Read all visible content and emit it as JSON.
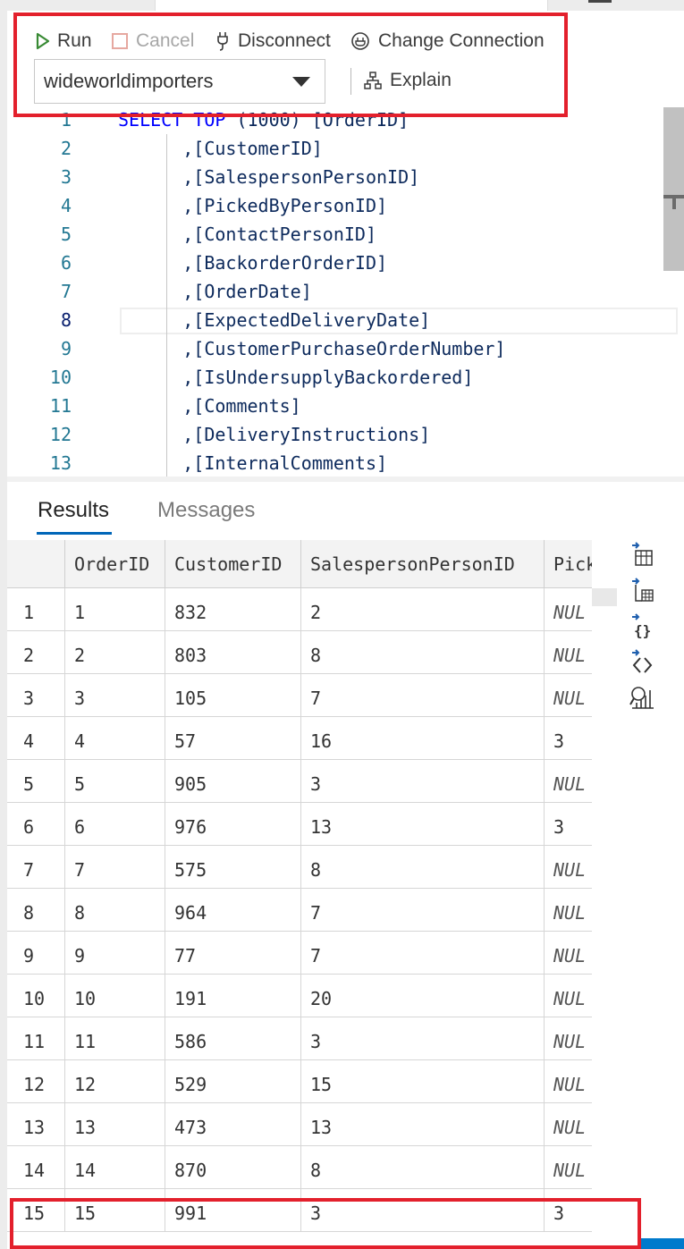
{
  "toolbar": {
    "run_label": "Run",
    "cancel_label": "Cancel",
    "disconnect_label": "Disconnect",
    "change_connection_label": "Change Connection",
    "database": "wideworldimporters",
    "explain_label": "Explain"
  },
  "editor": {
    "lines": [
      {
        "num": "1",
        "keyword": "SELECT TOP",
        "text": " (1000) [OrderID]"
      },
      {
        "num": "2",
        "keyword": "",
        "text": "      ,[CustomerID]"
      },
      {
        "num": "3",
        "keyword": "",
        "text": "      ,[SalespersonPersonID]"
      },
      {
        "num": "4",
        "keyword": "",
        "text": "      ,[PickedByPersonID]"
      },
      {
        "num": "5",
        "keyword": "",
        "text": "      ,[ContactPersonID]"
      },
      {
        "num": "6",
        "keyword": "",
        "text": "      ,[BackorderOrderID]"
      },
      {
        "num": "7",
        "keyword": "",
        "text": "      ,[OrderDate]"
      },
      {
        "num": "8",
        "keyword": "",
        "text": "      ,[ExpectedDeliveryDate]"
      },
      {
        "num": "9",
        "keyword": "",
        "text": "      ,[CustomerPurchaseOrderNumber]"
      },
      {
        "num": "10",
        "keyword": "",
        "text": "      ,[IsUndersupplyBackordered]"
      },
      {
        "num": "11",
        "keyword": "",
        "text": "      ,[Comments]"
      },
      {
        "num": "12",
        "keyword": "",
        "text": "      ,[DeliveryInstructions]"
      },
      {
        "num": "13",
        "keyword": "",
        "text": "      ,[InternalComments]"
      }
    ]
  },
  "results": {
    "tabs": [
      "Results",
      "Messages"
    ],
    "columns": [
      "OrderID",
      "CustomerID",
      "SalespersonPersonID",
      "Picked"
    ],
    "rows": [
      [
        "1",
        "1",
        "832",
        "2",
        "NUL"
      ],
      [
        "2",
        "2",
        "803",
        "8",
        "NUL"
      ],
      [
        "3",
        "3",
        "105",
        "7",
        "NUL"
      ],
      [
        "4",
        "4",
        "57",
        "16",
        "3"
      ],
      [
        "5",
        "5",
        "905",
        "3",
        "NUL"
      ],
      [
        "6",
        "6",
        "976",
        "13",
        "3"
      ],
      [
        "7",
        "7",
        "575",
        "8",
        "NUL"
      ],
      [
        "8",
        "8",
        "964",
        "7",
        "NUL"
      ],
      [
        "9",
        "9",
        "77",
        "7",
        "NUL"
      ],
      [
        "10",
        "10",
        "191",
        "20",
        "NUL"
      ],
      [
        "11",
        "11",
        "586",
        "3",
        "NUL"
      ],
      [
        "12",
        "12",
        "529",
        "15",
        "NUL"
      ],
      [
        "13",
        "13",
        "473",
        "13",
        "NUL"
      ],
      [
        "14",
        "14",
        "870",
        "8",
        "NUL"
      ],
      [
        "15",
        "15",
        "991",
        "3",
        "3"
      ]
    ]
  },
  "side_actions": [
    {
      "icon": "save-as-csv-icon"
    },
    {
      "icon": "save-as-excel-icon"
    },
    {
      "icon": "save-as-json-icon"
    },
    {
      "icon": "save-as-xml-icon"
    },
    {
      "icon": "chart-icon"
    }
  ],
  "colors": {
    "highlight_red": "#e3202c",
    "run_green": "#388a34",
    "keyword_blue": "#0000ff",
    "line_number": "#237893",
    "tab_underline": "#0066b8"
  }
}
